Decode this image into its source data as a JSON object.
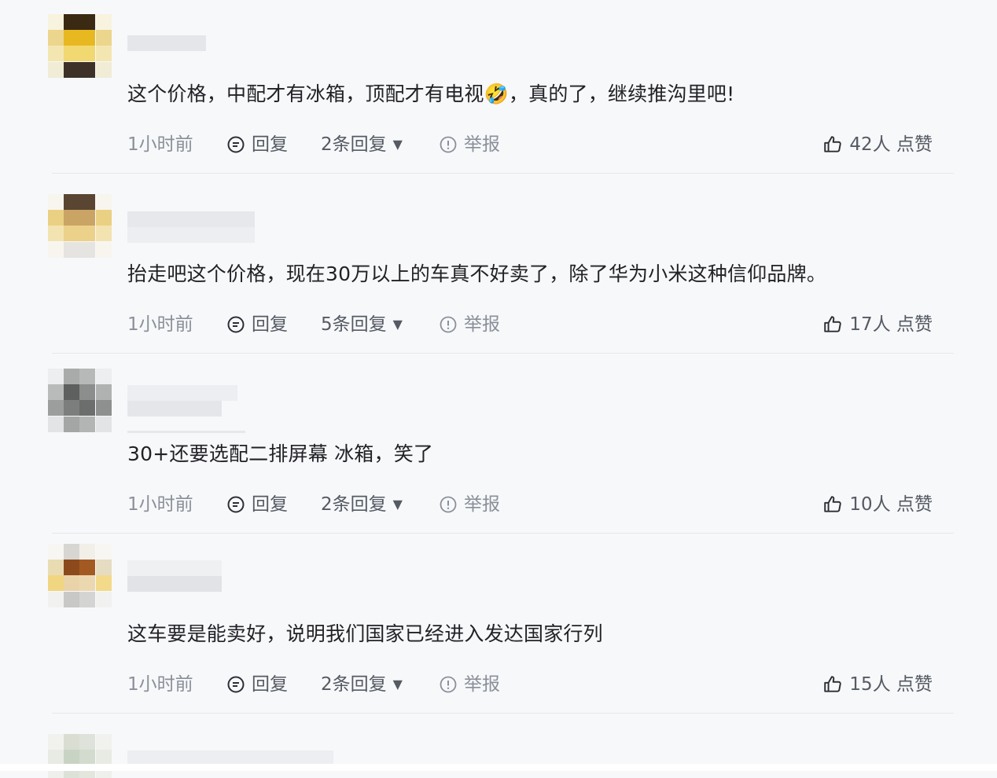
{
  "comments": [
    {
      "text": "这个价格，中配才有冰箱，顶配才有电视🤣，真的了，继续推沟里吧!",
      "time": "1小时前",
      "reply_label": "回复",
      "replies_label": "2条回复",
      "report_label": "举报",
      "likes_label": "42人 点赞"
    },
    {
      "text": "抬走吧这个价格，现在30万以上的车真不好卖了，除了华为小米这种信仰品牌。",
      "time": "1小时前",
      "reply_label": "回复",
      "replies_label": "5条回复",
      "report_label": "举报",
      "likes_label": "17人 点赞"
    },
    {
      "text": "30+还要选配二排屏幕 冰箱，笑了",
      "time": "1小时前",
      "reply_label": "回复",
      "replies_label": "2条回复",
      "report_label": "举报",
      "likes_label": "10人 点赞"
    },
    {
      "text": "这车要是能卖好，说明我们国家已经进入发达国家行列",
      "time": "1小时前",
      "reply_label": "回复",
      "replies_label": "2条回复",
      "report_label": "举报",
      "likes_label": "15人 点赞"
    }
  ],
  "icons": {
    "reply": "comment-bubble-icon",
    "dropdown": "caret-down-icon",
    "report": "warning-circle-icon",
    "like": "thumbs-up-icon"
  },
  "colors": {
    "background": "#f7f8fa",
    "text": "#222226",
    "muted": "#8a8f99",
    "divider": "#e6e8ec"
  }
}
